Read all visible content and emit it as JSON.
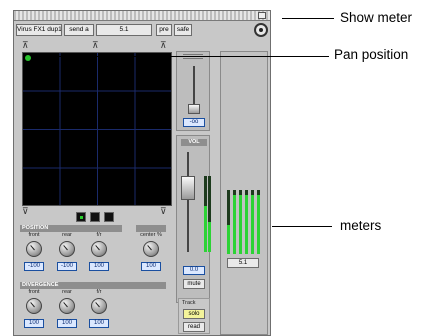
{
  "window": {
    "toolbar": {
      "track_name": "Virus FX1 dup1",
      "send": "send a",
      "format": "5.1",
      "pre": "pre",
      "safe": "safe"
    },
    "pan_grid": {
      "position": "front-left"
    },
    "position_section": {
      "title": "POSITION",
      "knobs": [
        {
          "label": "front",
          "value": "-100"
        },
        {
          "label": "rear",
          "value": "-100"
        },
        {
          "label": "f/r",
          "value": "100"
        }
      ],
      "center": {
        "label": "center %",
        "value": "100"
      }
    },
    "divergence_section": {
      "title": "DIVERGENCE",
      "knobs": [
        {
          "label": "front",
          "value": "100"
        },
        {
          "label": "rear",
          "value": "100"
        },
        {
          "label": "f/r",
          "value": "100"
        }
      ]
    },
    "lfe": {
      "value": "-oo"
    },
    "vol": {
      "label": "VOL",
      "value": "0.0",
      "mute": "mute"
    },
    "track": {
      "label": "Track",
      "solo": "solo",
      "read": "read"
    },
    "meters": {
      "format_label": "5.1",
      "levels": [
        0.45,
        0.92,
        0.92,
        0.92,
        0.92,
        0.92
      ]
    },
    "fader_meter_levels": [
      0.6,
      0.4
    ]
  },
  "annotations": {
    "show_meter": "Show meter",
    "pan_position": "Pan position",
    "meters": "meters"
  }
}
